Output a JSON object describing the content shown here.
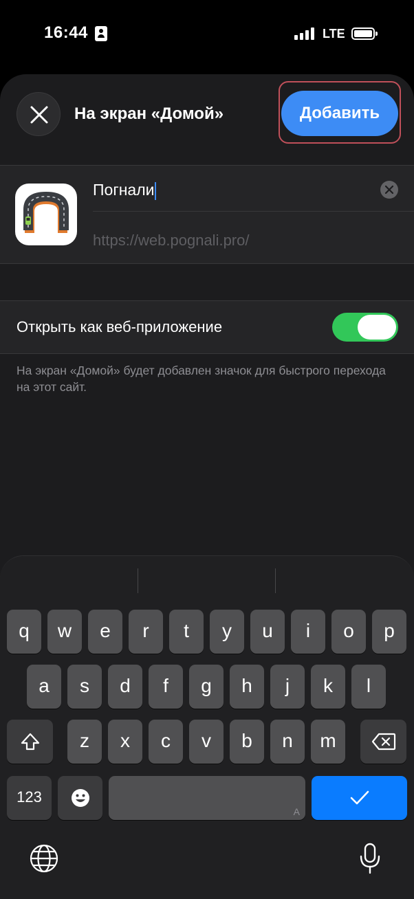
{
  "status_bar": {
    "time": "16:44",
    "network": "LTE"
  },
  "sheet": {
    "title": "На экран «Домой»",
    "add_button": "Добавить"
  },
  "bookmark": {
    "name": "Погнали",
    "url": "https://web.pognali.pro/"
  },
  "web_app_toggle": {
    "label": "Открыть как веб-приложение",
    "on": true
  },
  "footnote": "На экран «Домой» будет добавлен значок для быстрого перехода на этот сайт.",
  "keyboard": {
    "row1": [
      "q",
      "w",
      "e",
      "r",
      "t",
      "y",
      "u",
      "i",
      "o",
      "p"
    ],
    "row2": [
      "a",
      "s",
      "d",
      "f",
      "g",
      "h",
      "j",
      "k",
      "l"
    ],
    "row3": [
      "z",
      "x",
      "c",
      "v",
      "b",
      "n",
      "m"
    ],
    "numbers_key": "123",
    "space_hint": "A"
  },
  "colors": {
    "accent": "#3d8cf5",
    "toggle_on": "#32c759",
    "return_key": "#0a7cff"
  }
}
